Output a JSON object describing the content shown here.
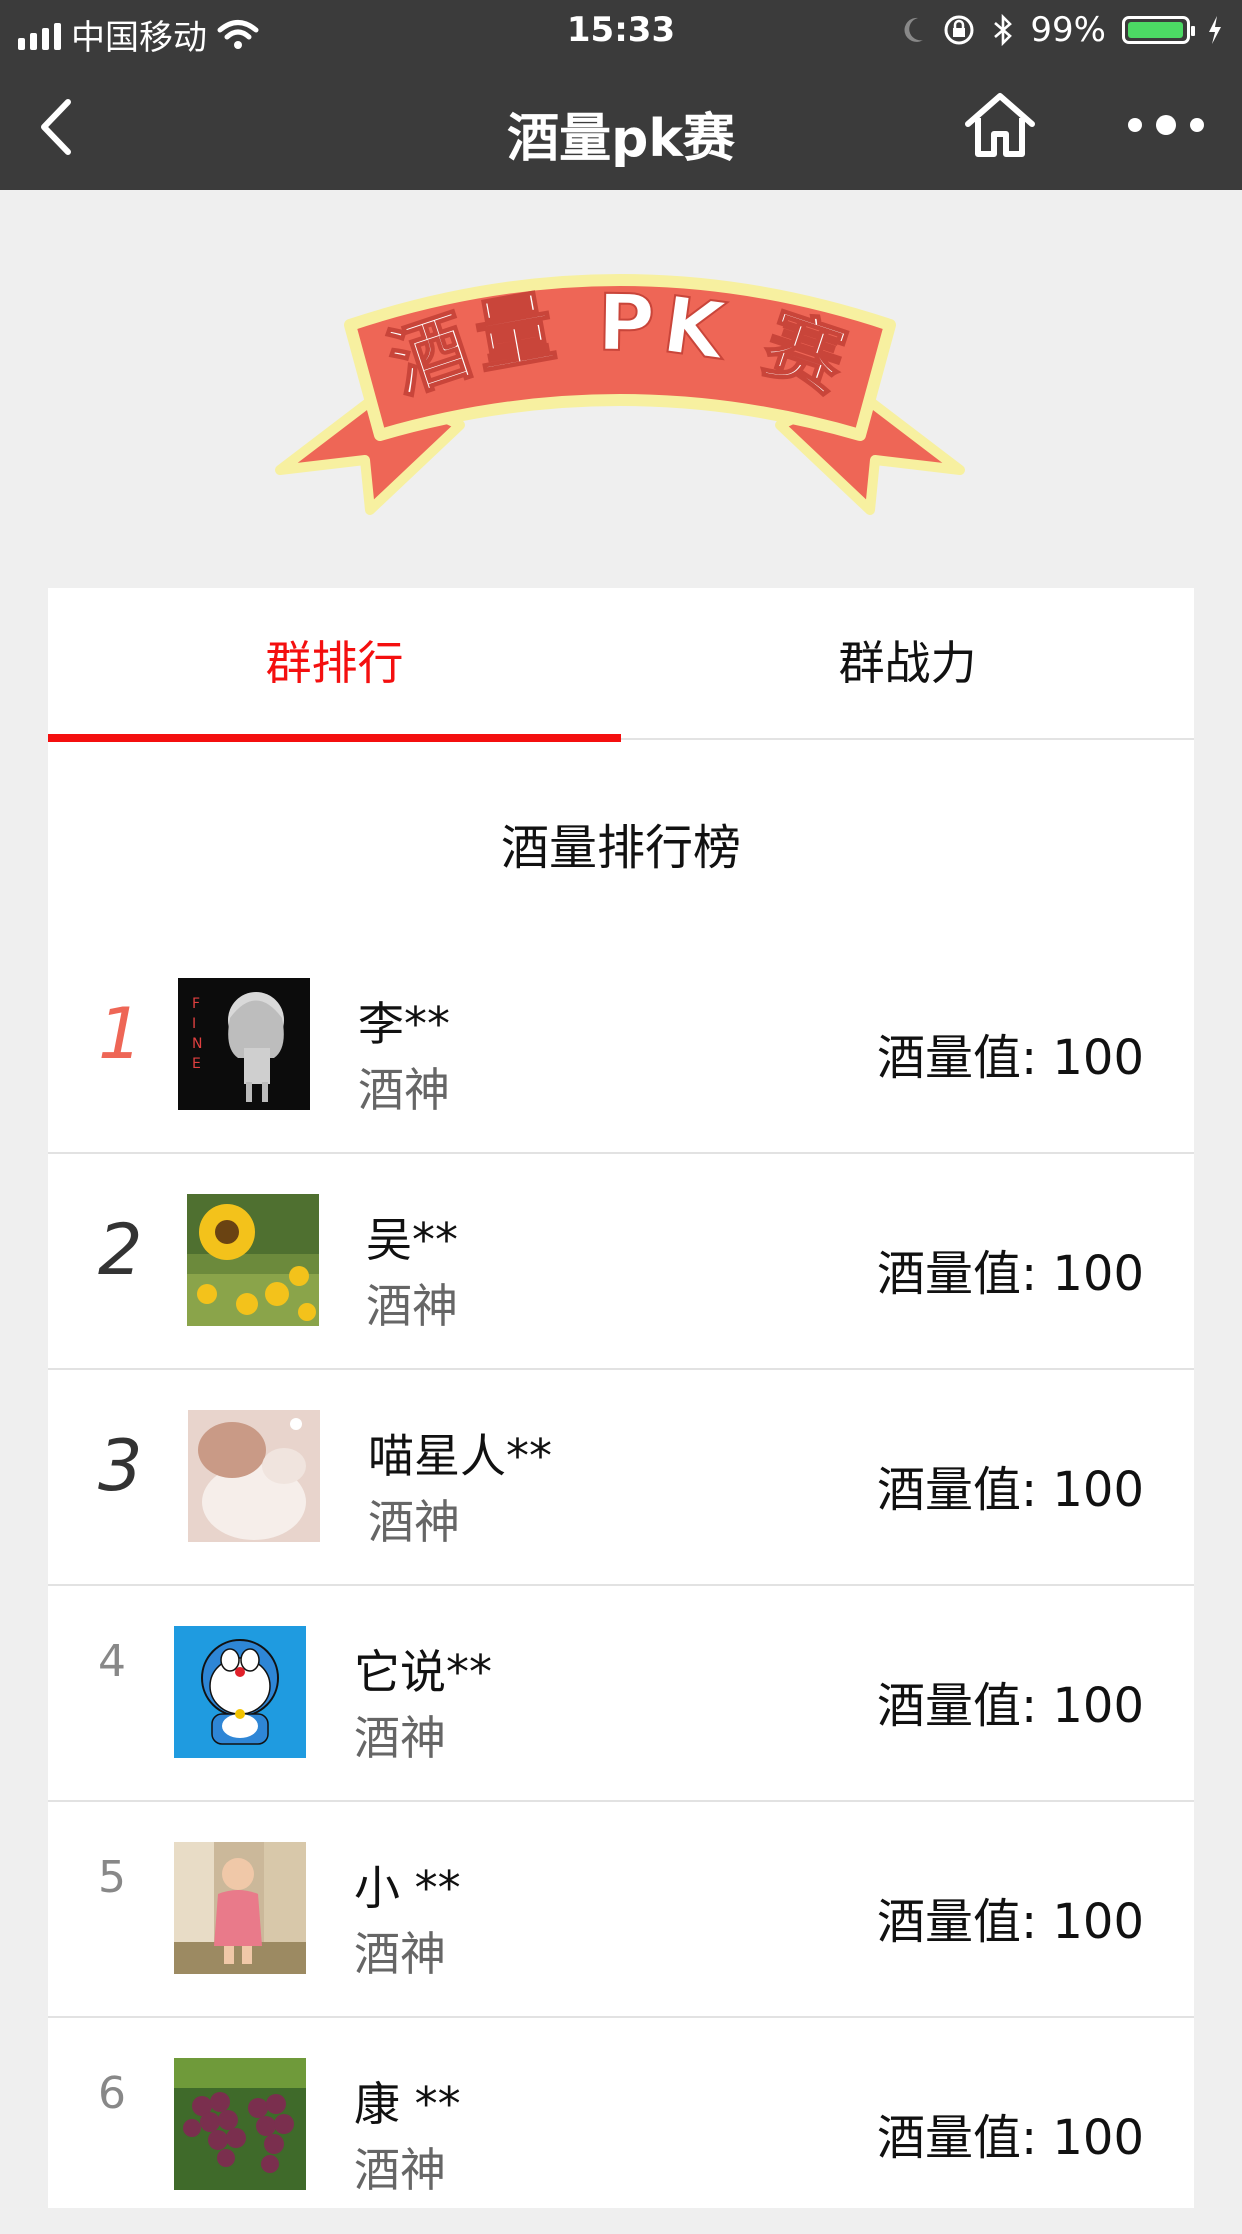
{
  "status_bar": {
    "carrier": "中国移动",
    "time": "15:33",
    "battery_percent": "99%",
    "battery_level": 0.99
  },
  "nav": {
    "title": "酒量pk赛",
    "icons": [
      "back-arrow-icon",
      "home-icon",
      "more-dots-icon"
    ]
  },
  "banner": {
    "text": "酒量 PK 赛",
    "colors": {
      "ribbon": "#ee6656",
      "outline": "#f7f0a0",
      "text": "#ffffff"
    }
  },
  "tabs": {
    "active_color": "#f40f0f",
    "items": [
      {
        "label": "群排行",
        "active": true
      },
      {
        "label": "群战力",
        "active": false
      }
    ]
  },
  "leaderboard": {
    "title": "酒量排行榜",
    "rows": [
      {
        "rank": "1",
        "name": "李**",
        "level": "酒神",
        "score": "酒量值: 100",
        "avatar": "fine-girl-avatar"
      },
      {
        "rank": "2",
        "name": "吴**",
        "level": "酒神",
        "score": "酒量值: 100",
        "avatar": "sunflower-avatar"
      },
      {
        "rank": "3",
        "name": "喵星人**",
        "level": "酒神",
        "score": "酒量值: 100",
        "avatar": "cat-avatar"
      },
      {
        "rank": "4",
        "name": "它说**",
        "level": "酒神",
        "score": "酒量值: 100",
        "avatar": "doraemon-avatar"
      },
      {
        "rank": "5",
        "name": "小 **",
        "level": "酒神",
        "score": "酒量值: 100",
        "avatar": "toddler-avatar"
      },
      {
        "rank": "6",
        "name": "康 **",
        "level": "酒神",
        "score": "酒量值: 100",
        "avatar": "grapes-avatar"
      }
    ]
  }
}
